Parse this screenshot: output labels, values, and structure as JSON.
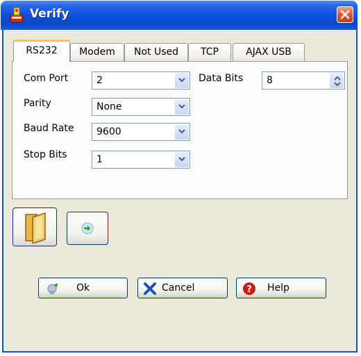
{
  "window": {
    "title": "Verify"
  },
  "tabs": [
    {
      "label": "RS232",
      "active": true
    },
    {
      "label": "Modem",
      "active": false
    },
    {
      "label": "Not Used",
      "active": false
    },
    {
      "label": "TCP",
      "active": false
    },
    {
      "label": "AJAX USB",
      "active": false
    }
  ],
  "rs232": {
    "com_port": {
      "label": "Com Port",
      "value": "2"
    },
    "parity": {
      "label": "Parity",
      "value": "None"
    },
    "baud_rate": {
      "label": "Baud Rate",
      "value": "9600"
    },
    "stop_bits": {
      "label": "Stop Bits",
      "value": "1"
    },
    "data_bits": {
      "label": "Data Bits",
      "value": "8"
    }
  },
  "toolbar": {
    "icons": [
      "folder-icon",
      "connect-arrow-icon"
    ]
  },
  "buttons": {
    "ok": "Ok",
    "cancel": "Cancel",
    "help": "Help"
  },
  "colors": {
    "titlebar": "#0a4fd8",
    "active_tab_accent": "#ffc83c",
    "close": "#e2593a"
  }
}
